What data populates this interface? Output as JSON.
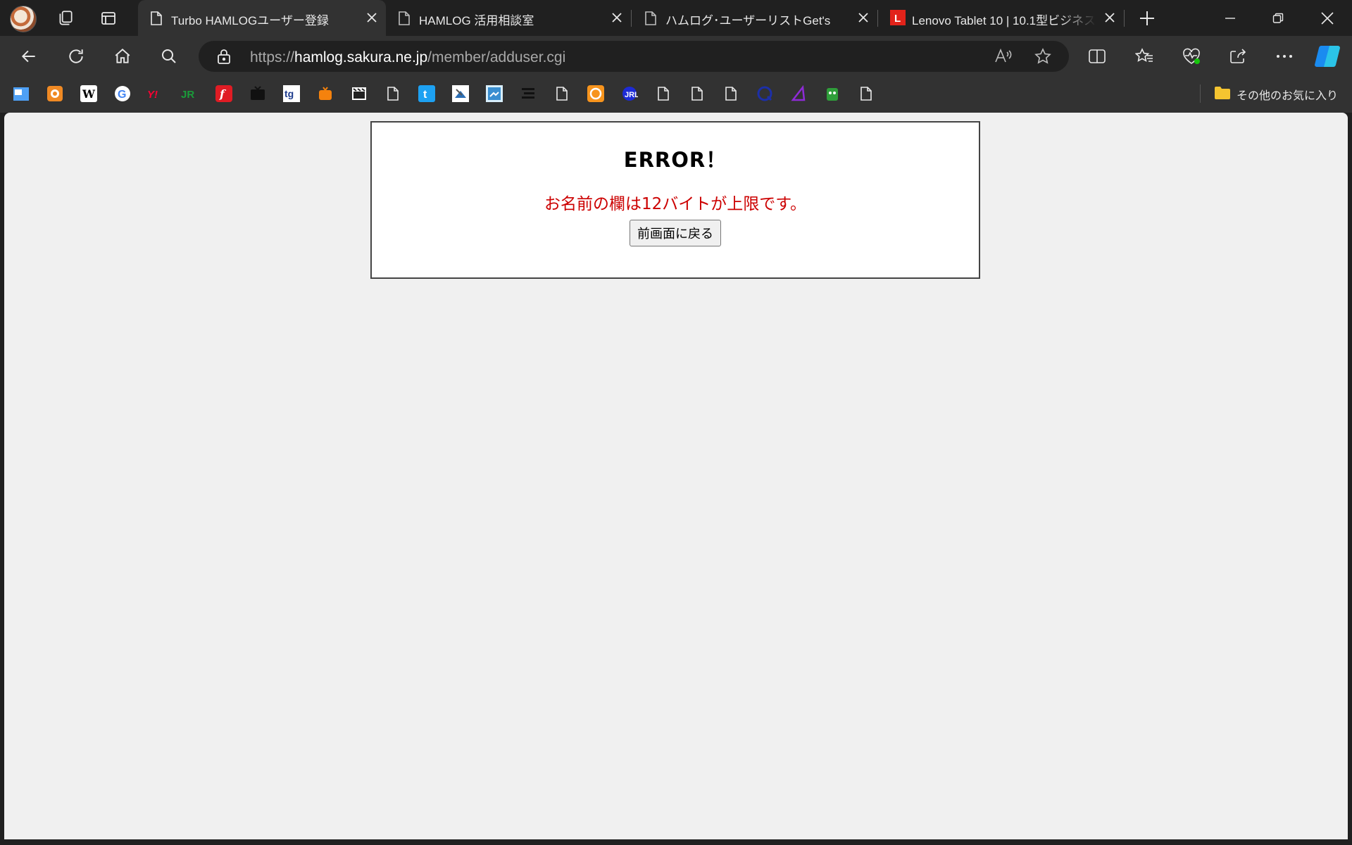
{
  "browser": {
    "tabs": [
      {
        "title": "Turbo HAMLOGユーザー登録",
        "active": true,
        "favicon": "page-icon"
      },
      {
        "title": "HAMLOG 活用相談室",
        "active": false,
        "favicon": "page-icon"
      },
      {
        "title": "ハムログ･ユーザーリストGet's",
        "active": false,
        "favicon": "page-icon"
      },
      {
        "title": "Lenovo Tablet 10 | 10.1型ビジネス",
        "active": false,
        "favicon": "lenovo-icon"
      }
    ],
    "url": {
      "scheme": "https://",
      "host": "hamlog.sakura.ne.jp",
      "path": "/member/adduser.cgi"
    },
    "favorites": {
      "other_label": "その他のお気に入り"
    }
  },
  "page": {
    "error_title": "ERROR！",
    "error_message": "お名前の欄は12バイトが上限です。",
    "back_button_label": "前画面に戻る"
  },
  "colors": {
    "error_text": "#cc0000",
    "chrome_dark": "#202020",
    "chrome_mid": "#323232",
    "page_bg": "#f0f0f0"
  }
}
